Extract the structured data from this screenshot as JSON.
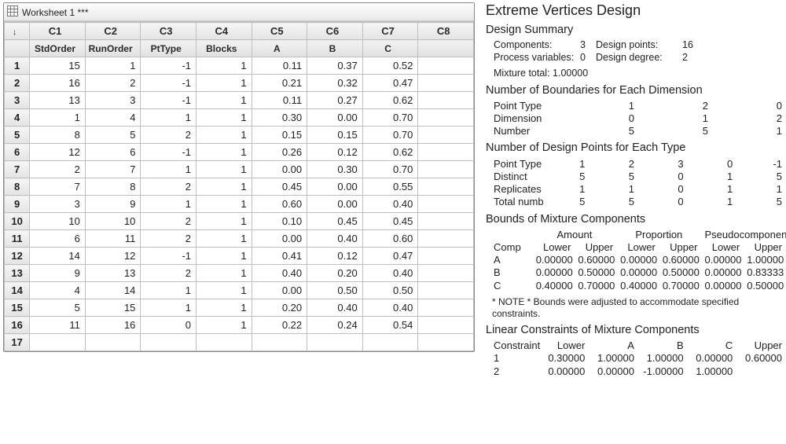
{
  "worksheet": {
    "title": "Worksheet 1 ***",
    "arrow": "↓",
    "col_letters": [
      "C1",
      "C2",
      "C3",
      "C4",
      "C5",
      "C6",
      "C7",
      "C8"
    ],
    "col_names": [
      "StdOrder",
      "RunOrder",
      "PtType",
      "Blocks",
      "A",
      "B",
      "C",
      ""
    ],
    "rows": [
      [
        "15",
        "1",
        "-1",
        "1",
        "0.11",
        "0.37",
        "0.52",
        ""
      ],
      [
        "16",
        "2",
        "-1",
        "1",
        "0.21",
        "0.32",
        "0.47",
        ""
      ],
      [
        "13",
        "3",
        "-1",
        "1",
        "0.11",
        "0.27",
        "0.62",
        ""
      ],
      [
        "1",
        "4",
        "1",
        "1",
        "0.30",
        "0.00",
        "0.70",
        ""
      ],
      [
        "8",
        "5",
        "2",
        "1",
        "0.15",
        "0.15",
        "0.70",
        ""
      ],
      [
        "12",
        "6",
        "-1",
        "1",
        "0.26",
        "0.12",
        "0.62",
        ""
      ],
      [
        "2",
        "7",
        "1",
        "1",
        "0.00",
        "0.30",
        "0.70",
        ""
      ],
      [
        "7",
        "8",
        "2",
        "1",
        "0.45",
        "0.00",
        "0.55",
        ""
      ],
      [
        "3",
        "9",
        "1",
        "1",
        "0.60",
        "0.00",
        "0.40",
        ""
      ],
      [
        "10",
        "10",
        "2",
        "1",
        "0.10",
        "0.45",
        "0.45",
        ""
      ],
      [
        "6",
        "11",
        "2",
        "1",
        "0.00",
        "0.40",
        "0.60",
        ""
      ],
      [
        "14",
        "12",
        "-1",
        "1",
        "0.41",
        "0.12",
        "0.47",
        ""
      ],
      [
        "9",
        "13",
        "2",
        "1",
        "0.40",
        "0.20",
        "0.40",
        ""
      ],
      [
        "4",
        "14",
        "1",
        "1",
        "0.00",
        "0.50",
        "0.50",
        ""
      ],
      [
        "5",
        "15",
        "1",
        "1",
        "0.20",
        "0.40",
        "0.40",
        ""
      ],
      [
        "11",
        "16",
        "0",
        "1",
        "0.22",
        "0.24",
        "0.54",
        ""
      ],
      [
        "",
        "",
        "",
        "",
        "",
        "",
        "",
        ""
      ]
    ]
  },
  "report": {
    "title": "Extreme Vertices Design",
    "design_summary_h": "Design Summary",
    "summary": {
      "components_l": "Components:",
      "components_v": "3",
      "designpoints_l": "Design points:",
      "designpoints_v": "16",
      "procvars_l": "Process variables:",
      "procvars_v": "0",
      "designdeg_l": "Design degree:",
      "designdeg_v": "2"
    },
    "mixture_total": "Mixture total: 1.00000",
    "boundaries_h": "Number of Boundaries for Each Dimension",
    "boundaries": {
      "hdr": [
        "Point Type",
        "1",
        "2",
        "0"
      ],
      "dim": [
        "Dimension",
        "0",
        "1",
        "2"
      ],
      "num": [
        "Number",
        "5",
        "5",
        "1"
      ]
    },
    "dpt_h": "Number of Design Points for Each Type",
    "dpt": {
      "hdr": [
        "Point Type",
        "1",
        "2",
        "3",
        "0",
        "-1"
      ],
      "distinct": [
        "Distinct",
        "5",
        "5",
        "0",
        "1",
        "5"
      ],
      "replicates": [
        "Replicates",
        "1",
        "1",
        "0",
        "1",
        "1"
      ],
      "total": [
        "Total number",
        "5",
        "5",
        "0",
        "1",
        "5"
      ]
    },
    "bounds_h": "Bounds of Mixture Components",
    "bounds": {
      "group_hdr": [
        "",
        "Amount",
        "Proportion",
        "Pseudocomponent"
      ],
      "col_hdr": [
        "Comp",
        "Lower",
        "Upper",
        "Lower",
        "Upper",
        "Lower",
        "Upper"
      ],
      "rows": [
        [
          "A",
          "0.00000",
          "0.60000",
          "0.00000",
          "0.60000",
          "0.00000",
          "1.00000"
        ],
        [
          "B",
          "0.00000",
          "0.50000",
          "0.00000",
          "0.50000",
          "0.00000",
          "0.83333"
        ],
        [
          "C",
          "0.40000",
          "0.70000",
          "0.40000",
          "0.70000",
          "0.00000",
          "0.50000"
        ]
      ]
    },
    "note": "* NOTE * Bounds were adjusted to accommodate specified constraints.",
    "lin_h": "Linear Constraints of Mixture Components",
    "lin": {
      "hdr": [
        "Constraint",
        "Lower",
        "A",
        "B",
        "C",
        "Upper"
      ],
      "rows": [
        [
          "1",
          "0.30000",
          "1.00000",
          "1.00000",
          "0.00000",
          "0.60000"
        ],
        [
          "2",
          "0.00000",
          "0.00000",
          "-1.00000",
          "1.00000",
          ""
        ]
      ]
    }
  }
}
